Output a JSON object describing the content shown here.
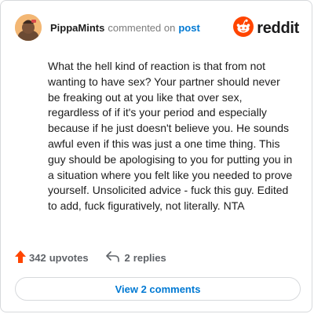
{
  "header": {
    "username": "PippaMints",
    "action_text": "commented on",
    "target_link": "post",
    "brand_word": "reddit"
  },
  "comment": {
    "text": "What the hell kind of reaction is that from not wanting to have sex? Your partner should never be freaking out at you like that over sex, regardless of if it's your period and especially because if he just doesn't believe you. He sounds awful even if this was just a one time thing. This guy should be apologising to you for putting you in a situation where you felt like you needed to prove yourself. Unsolicited advice - fuck this guy. Edited to add, fuck figuratively, not literally. NTA"
  },
  "actions": {
    "upvotes_count": "342",
    "upvotes_label": "upvotes",
    "replies_count": "2",
    "replies_label": "replies"
  },
  "view_comments_label": "View 2 comments",
  "colors": {
    "upvote_icon": "#ff4500",
    "link_blue": "#0079d3",
    "reddit_orange": "#ff4500"
  },
  "icons": {
    "avatar": "avatar-illustration",
    "upvote": "upvote-arrow-icon",
    "reply": "reply-arrow-icon",
    "brand": "reddit-snoo-icon"
  }
}
